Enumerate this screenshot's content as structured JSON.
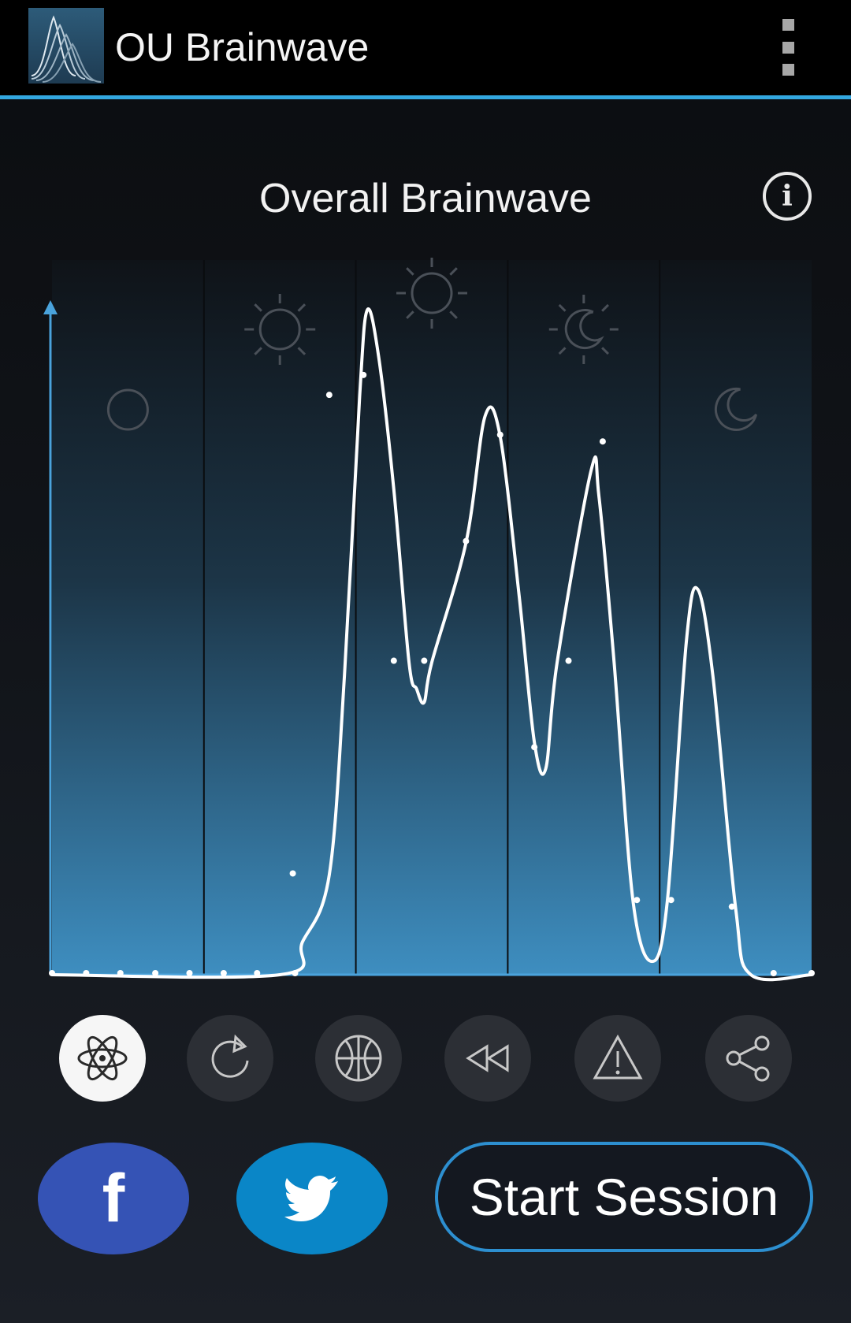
{
  "app": {
    "title": "OU Brainwave",
    "logo_icon": "brainwave-logo-icon",
    "menu_icon": "overflow-menu-icon",
    "accent_color": "#33a7e0"
  },
  "main": {
    "section_title": "Overall Brainwave",
    "info_label": "i",
    "info_icon": "info-icon"
  },
  "chart_data": {
    "type": "area",
    "title": "",
    "xlabel": "",
    "ylabel": "",
    "bands": [
      {
        "icon": "circle-icon"
      },
      {
        "icon": "sun-icon"
      },
      {
        "icon": "sun-bright-icon"
      },
      {
        "icon": "moon-rays-icon"
      },
      {
        "icon": "moon-icon"
      }
    ],
    "x": [
      0,
      0.045,
      0.09,
      0.136,
      0.181,
      0.226,
      0.27,
      0.32,
      0.365,
      0.41,
      0.45,
      0.545,
      0.59,
      0.615,
      0.63,
      0.77,
      0.81,
      0.845,
      0.85,
      0.9,
      0.94,
      0.954,
      1.0
    ],
    "values": [
      0,
      0,
      0,
      0,
      0,
      0,
      0,
      0.0,
      0.15,
      0.87,
      0.9,
      0.47,
      0.47,
      0.81,
      0.86,
      0.78,
      0.47,
      0.34,
      0.11,
      0.11,
      0.1,
      0,
      0
    ],
    "curve": [
      [
        0,
        0
      ],
      [
        0.3,
        0
      ],
      [
        0.33,
        0.05
      ],
      [
        0.365,
        0.15
      ],
      [
        0.385,
        0.45
      ],
      [
        0.405,
        0.87
      ],
      [
        0.415,
        1.0
      ],
      [
        0.43,
        0.93
      ],
      [
        0.45,
        0.73
      ],
      [
        0.47,
        0.47
      ],
      [
        0.48,
        0.43
      ],
      [
        0.49,
        0.41
      ],
      [
        0.5,
        0.47
      ],
      [
        0.545,
        0.65
      ],
      [
        0.57,
        0.84
      ],
      [
        0.59,
        0.81
      ],
      [
        0.615,
        0.57
      ],
      [
        0.635,
        0.35
      ],
      [
        0.65,
        0.31
      ],
      [
        0.665,
        0.47
      ],
      [
        0.71,
        0.76
      ],
      [
        0.72,
        0.72
      ],
      [
        0.74,
        0.47
      ],
      [
        0.765,
        0.11
      ],
      [
        0.79,
        0.02
      ],
      [
        0.81,
        0.11
      ],
      [
        0.835,
        0.5
      ],
      [
        0.85,
        0.58
      ],
      [
        0.87,
        0.45
      ],
      [
        0.9,
        0.1
      ],
      [
        0.92,
        0
      ],
      [
        1.0,
        0
      ]
    ],
    "markers": [
      [
        0,
        0
      ],
      [
        0.045,
        0
      ],
      [
        0.09,
        0
      ],
      [
        0.136,
        0
      ],
      [
        0.181,
        0
      ],
      [
        0.226,
        0
      ],
      [
        0.27,
        0
      ],
      [
        0.32,
        0
      ],
      [
        0.317,
        0.15
      ],
      [
        0.365,
        0.87
      ],
      [
        0.41,
        0.9
      ],
      [
        0.45,
        0.47
      ],
      [
        0.49,
        0.47
      ],
      [
        0.545,
        0.65
      ],
      [
        0.59,
        0.81
      ],
      [
        0.635,
        0.34
      ],
      [
        0.68,
        0.47
      ],
      [
        0.725,
        0.8
      ],
      [
        0.77,
        0.11
      ],
      [
        0.815,
        0.11
      ],
      [
        0.895,
        0.1
      ],
      [
        0.95,
        0
      ],
      [
        1.0,
        0
      ]
    ],
    "ylim": [
      0,
      1
    ],
    "grid": false,
    "legend": "none",
    "fill_color_top": "#0f1318",
    "fill_color_bottom": "#3e8ec0",
    "line_color": "#ffffff",
    "axis_color": "#4aa3dc"
  },
  "controls": [
    {
      "name": "atom-mode-button",
      "icon": "atom-icon",
      "active": true
    },
    {
      "name": "replay-button",
      "icon": "replay-icon",
      "active": false
    },
    {
      "name": "sport-mode-button",
      "icon": "basketball-icon",
      "active": false
    },
    {
      "name": "rewind-button",
      "icon": "rewind-icon",
      "active": false
    },
    {
      "name": "alert-button",
      "icon": "warning-icon",
      "active": false
    },
    {
      "name": "share-button",
      "icon": "share-icon",
      "active": false
    }
  ],
  "actions": {
    "facebook_label": "f",
    "facebook_color": "#3553b5",
    "twitter_icon": "twitter-bird-icon",
    "twitter_color": "#0a86c7",
    "start_session_label": "Start Session",
    "start_border_color": "#2d8fd0"
  }
}
